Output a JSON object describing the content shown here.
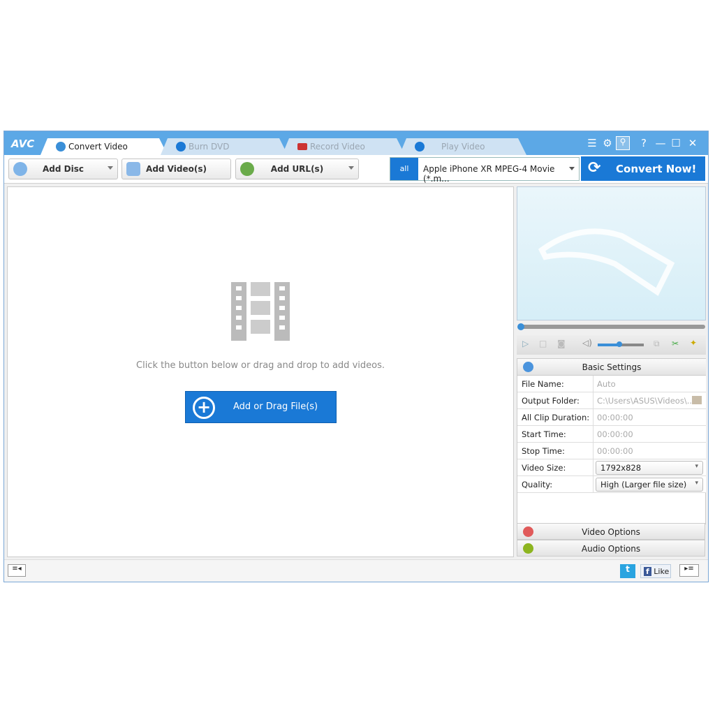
{
  "app": {
    "logo": "AVC"
  },
  "tabs": [
    {
      "label": "Convert Video",
      "active": true
    },
    {
      "label": "Burn DVD"
    },
    {
      "label": "Record Video"
    },
    {
      "label": "Play Video"
    }
  ],
  "window_controls": {
    "help": "?",
    "minimize": "—",
    "maximize": "☐",
    "close": "✕"
  },
  "toolbar": {
    "add_disc": "Add Disc",
    "add_videos": "Add Video(s)",
    "add_url": "Add URL(s)",
    "profile": "Apple iPhone XR MPEG-4 Movie (*.m...",
    "profile_icon": "all",
    "convert": "Convert Now!"
  },
  "main": {
    "hint": "Click the button below or drag and drop to add videos.",
    "add_button": "Add or Drag File(s)"
  },
  "settings": {
    "title": "Basic Settings",
    "rows": [
      {
        "label": "File Name:",
        "value": "Auto"
      },
      {
        "label": "Output Folder:",
        "value": "C:\\Users\\ASUS\\Videos\\..."
      },
      {
        "label": "All Clip Duration:",
        "value": "00:00:00"
      },
      {
        "label": "Start Time:",
        "value": "00:00:00"
      },
      {
        "label": "Stop Time:",
        "value": "00:00:00"
      },
      {
        "label": "Video Size:",
        "value": "1792x828"
      },
      {
        "label": "Quality:",
        "value": "High (Larger file size)"
      }
    ],
    "video_options": "Video Options",
    "audio_options": "Audio Options"
  },
  "player": {
    "volume": 0.45,
    "seek": 0
  },
  "status": {
    "like": "Like"
  },
  "colors": {
    "title_bar": "#5ca8e6",
    "accent": "#1a79d6"
  }
}
